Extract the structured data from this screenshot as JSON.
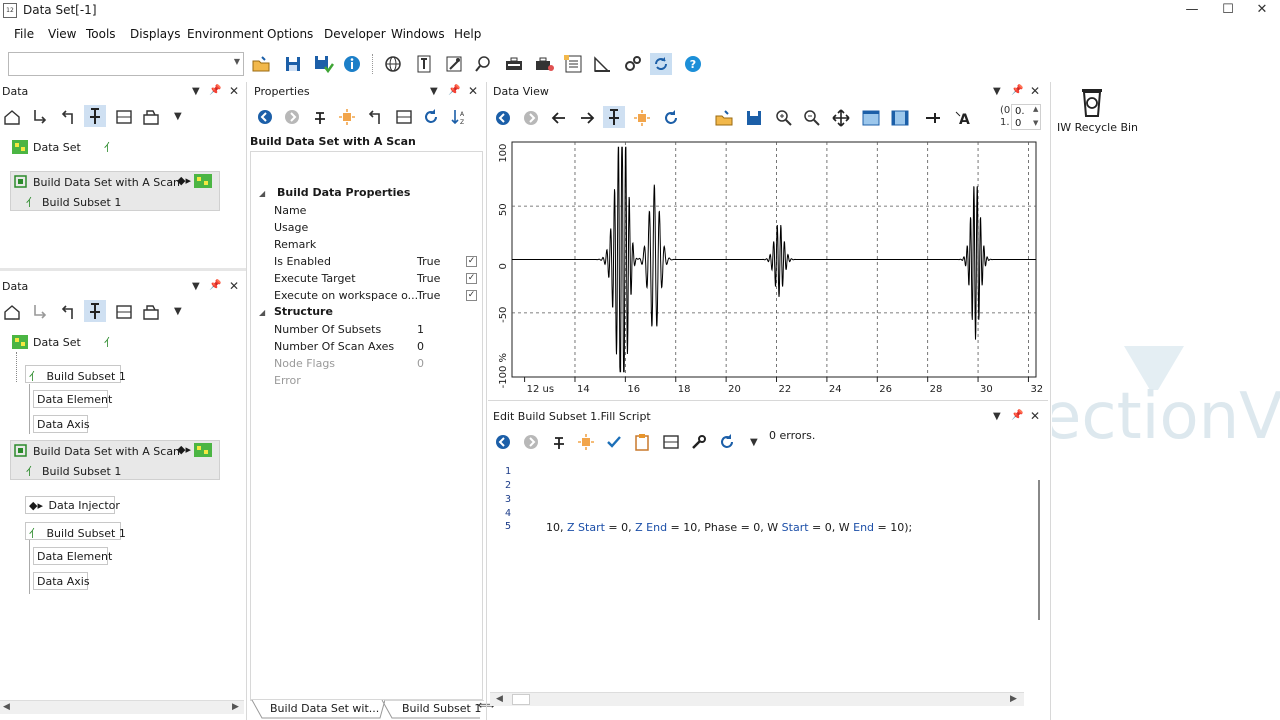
{
  "window": {
    "title": "Data Set[-1]",
    "app_icon": "12",
    "minimize": "—",
    "maximize": "☐",
    "close": "✕"
  },
  "menu": [
    "File",
    "View",
    "Tools",
    "Displays",
    "Environment",
    "Options",
    "Developer",
    "Windows",
    "Help"
  ],
  "toolbar": {
    "combo_value": ""
  },
  "data_panel_top": {
    "title": "Data",
    "nodes": [
      {
        "label": "Data Set"
      },
      {
        "label": "Build Data Set with A Scan"
      },
      {
        "label": "Build Subset 1"
      }
    ]
  },
  "data_panel_bottom": {
    "title": "Data",
    "nodes": [
      {
        "label": "Data Set"
      },
      {
        "label": "Build Subset 1"
      },
      {
        "label": "Data Element"
      },
      {
        "label": "Data Axis"
      },
      {
        "label": "Build Data Set with A Scan"
      },
      {
        "label": "Build Subset 1"
      },
      {
        "label": "Data Injector"
      },
      {
        "label": "Build Subset 1"
      },
      {
        "label": "Data Element"
      },
      {
        "label": "Data Axis"
      }
    ]
  },
  "properties": {
    "title": "Properties",
    "heading": "Build Data Set with A Scan",
    "group1": "Build Data Properties",
    "rows": [
      {
        "name": "Name",
        "value": ""
      },
      {
        "name": "Usage",
        "value": ""
      },
      {
        "name": "Remark",
        "value": ""
      },
      {
        "name": "Is Enabled",
        "value": "True",
        "check": "✓"
      },
      {
        "name": "Execute Target",
        "value": "True",
        "check": "✓"
      },
      {
        "name": "Execute on workspace o...",
        "value": "True",
        "check": "✓"
      }
    ],
    "group2": "Structure",
    "rows2": [
      {
        "name": "Number Of Subsets",
        "value": "1"
      },
      {
        "name": "Number Of Scan Axes",
        "value": "0"
      },
      {
        "name": "Node Flags",
        "value": "0"
      },
      {
        "name": "Error",
        "value": ""
      }
    ]
  },
  "bottom_tabs": [
    "Build Data Set wit...",
    "Build Subset 1"
  ],
  "data_view": {
    "title": "Data View",
    "corner_top": "(0",
    "corner_top2": "0.",
    "corner_bottom": "1.",
    "corner_bottom2": "0"
  },
  "chart_data": {
    "type": "line",
    "x_ticks": [
      "12 us",
      "14",
      "16",
      "18",
      "20",
      "22",
      "24",
      "26",
      "28",
      "30",
      "32"
    ],
    "y_ticks": [
      "100",
      "50",
      "0",
      "-50",
      "-100 %"
    ],
    "xlim": [
      11.5,
      32.3
    ],
    "ylim": [
      -110,
      110
    ],
    "grid": true,
    "series": [
      {
        "values": []
      }
    ]
  },
  "editor": {
    "title": "Edit Build Subset 1.Fill Script",
    "status": "0 errors.",
    "line_numbers": [
      "1",
      "2",
      "3",
      "4",
      "5"
    ],
    "line5": {
      "t1": "10, ",
      "k1": "Z Start",
      "t2": " = 0, ",
      "k2": "Z End",
      "t3": " = 10, Phase = 0, W ",
      "k3": "Start",
      "t4": " = 0, W ",
      "k4": "End",
      "t5": " = 10);"
    }
  },
  "recycle_bin": {
    "label": "IW Recycle Bin"
  },
  "watermark": "ectionV",
  "colors": {
    "accent_blue": "#1c5fa8",
    "green": "#3fa535",
    "orange": "#e8952b"
  }
}
